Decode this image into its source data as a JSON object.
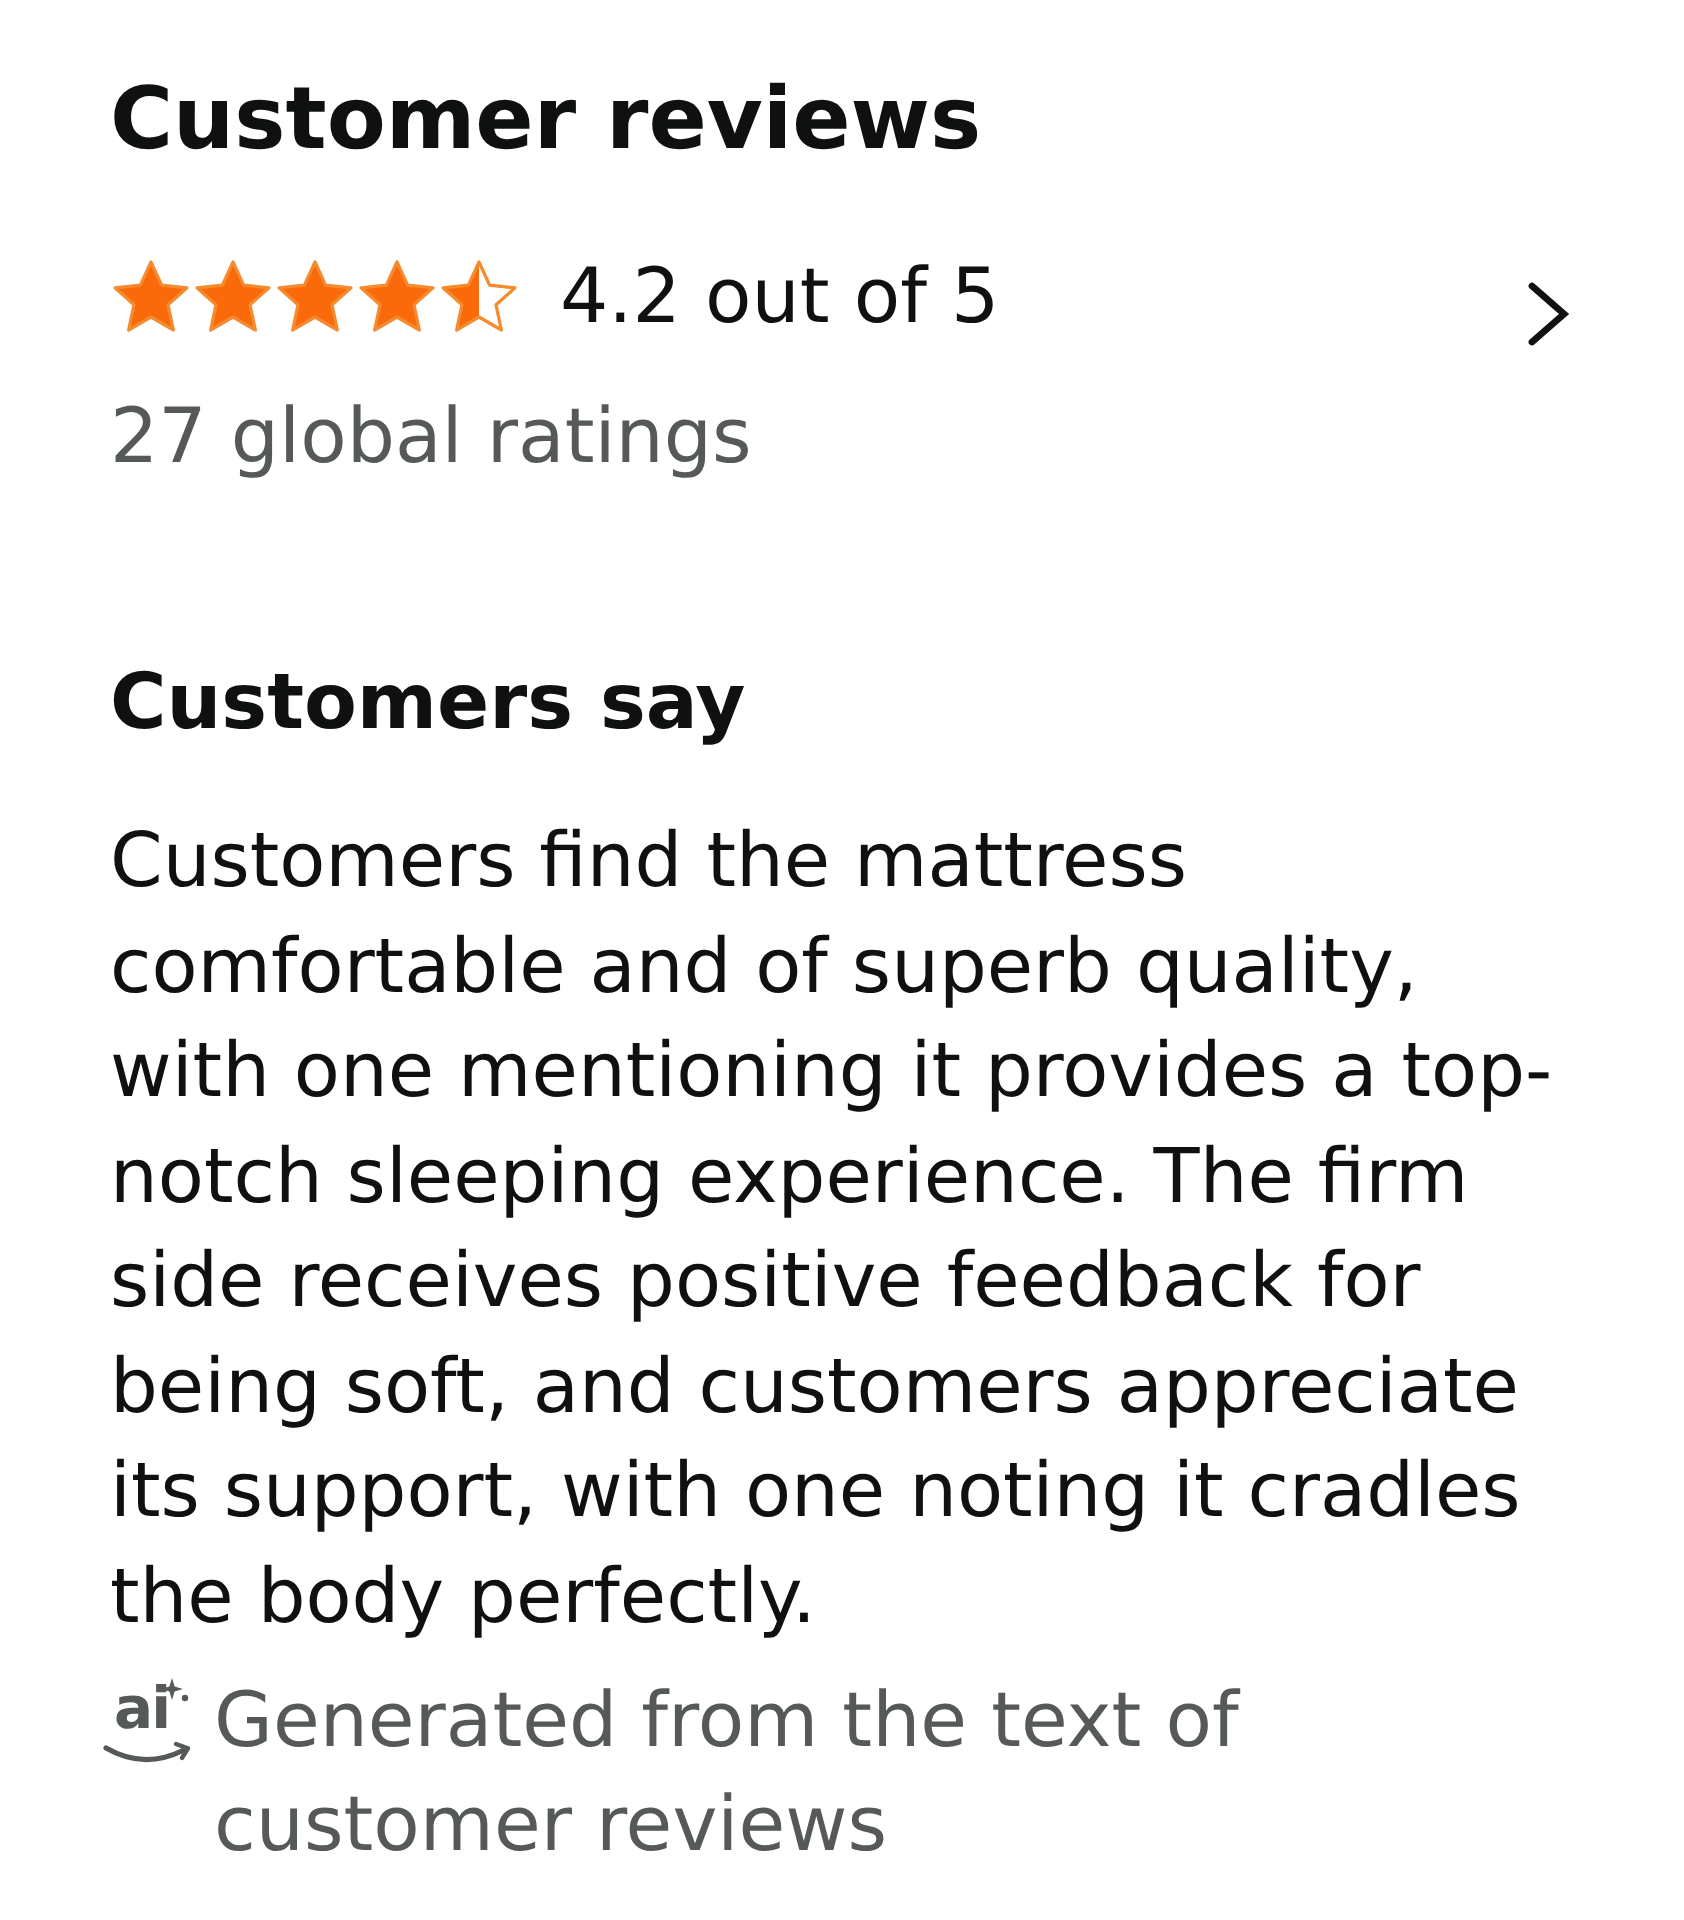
{
  "customer_reviews": {
    "title": "Customer reviews",
    "rating": {
      "stars": 4.5,
      "text": "4.2 out of 5"
    },
    "ratings_count": "27 global ratings"
  },
  "customers_say": {
    "heading": "Customers say",
    "summary": "Customers find the mattress comfortable and of superb quality, with one mentioning it provides a top-notch sleeping experience. The firm side receives positive feedback for being soft, and customers appreciate its support, with one noting it cradles the body perfectly.",
    "ai_badge": "ai",
    "note": "Generated from the text of customer reviews"
  }
}
